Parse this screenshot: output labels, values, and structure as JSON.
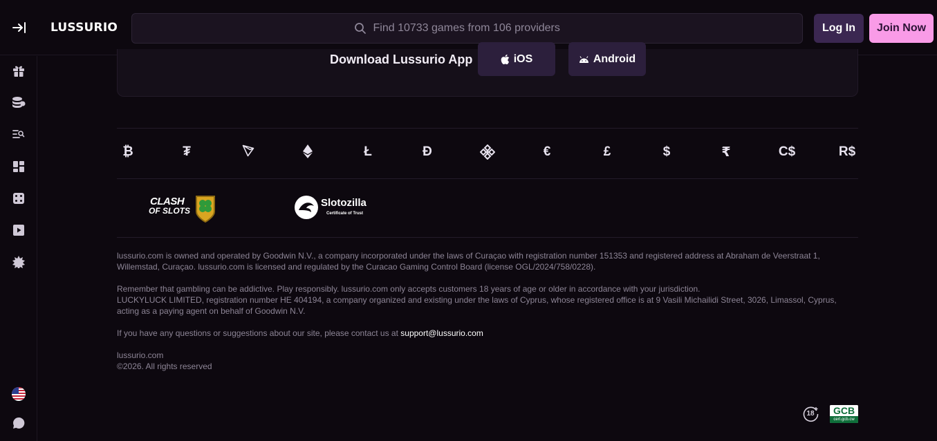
{
  "header": {
    "logo": "LUSSURIO",
    "search_placeholder": "Find 10733 games from 106 providers",
    "login_label": "Log In",
    "join_label": "Join Now"
  },
  "sidebar": {
    "icons": [
      "gift-icon",
      "coins-icon",
      "search-list-icon",
      "grid-icon",
      "dice-icon",
      "play-icon",
      "starburst-icon",
      "us-flag-icon",
      "chat-icon"
    ]
  },
  "app_download": {
    "title": "Download Lussurio App",
    "ios_label": "iOS",
    "android_label": "Android"
  },
  "currencies": [
    "₿",
    "₮",
    "◁",
    "♦",
    "Ł",
    "Đ",
    "◈",
    "€",
    "£",
    "$",
    "₹",
    "C$",
    "R$"
  ],
  "partners": {
    "clash_line1": "CLASH",
    "clash_line2": "OF SLOTS",
    "slotozilla_name": "Slotozilla",
    "slotozilla_sub": "Certificate of Trust"
  },
  "legal": {
    "p1": "lussurio.com is owned and operated by Goodwin N.V., a company incorporated under the laws of Curaçao with registration number 151353 and registered address at Abraham de Veerstraat 1, Willemstad, Curaçao. lussurio.com is licensed and regulated by the Curacao Gaming Control Board (license OGL/2024/758/0228).",
    "p2": "Remember that gambling can be addictive. Play responsibly. lussurio.com only accepts customers 18 years of age or older in accordance with your jurisdiction.",
    "p3": "LUCKYLUCK LIMITED, registration number HE 404194, a company organized and existing under the laws of Cyprus, whose registered office is at 9 Vasili Michailidi Street, 3026, Limassol, Cyprus, acting as a paying agent on behalf of Goodwin N.V.",
    "p4_text": "If you have any questions or suggestions about our site, please contact us at ",
    "p4_email": "support@lussurio.com",
    "site": "lussurio.com",
    "copyright": "©2026. All rights reserved"
  },
  "badges": {
    "age": "18",
    "gcb": "GCB",
    "gcb_sub": "cert.gcb.cw"
  }
}
